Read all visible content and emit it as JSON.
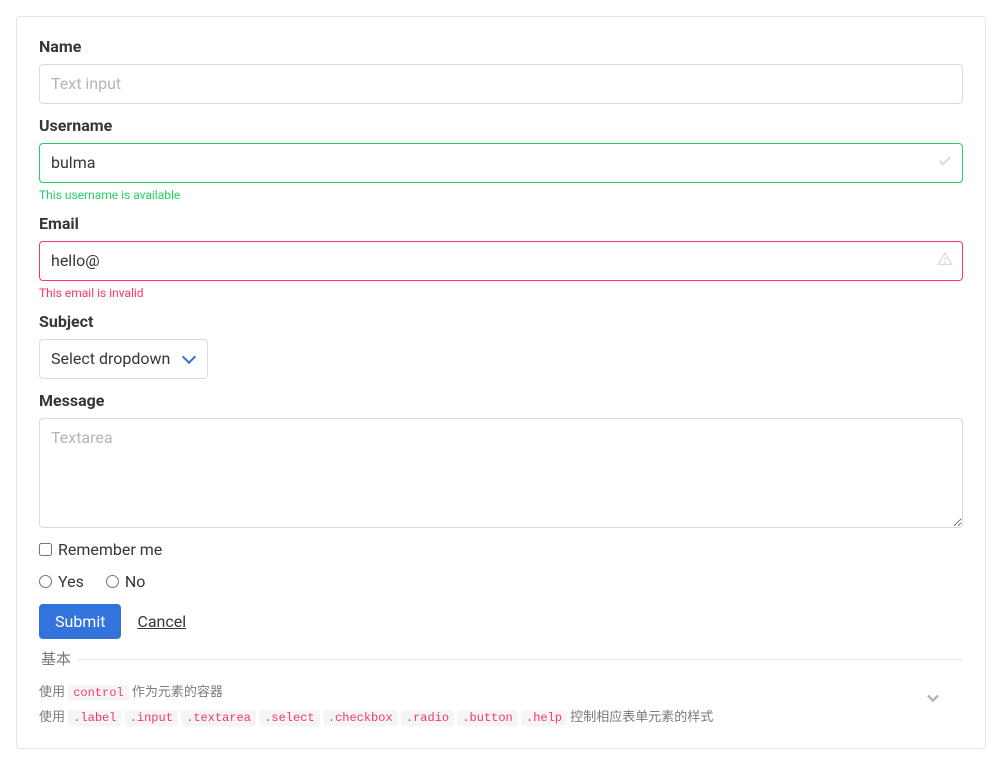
{
  "form": {
    "name": {
      "label": "Name",
      "placeholder": "Text input"
    },
    "username": {
      "label": "Username",
      "value": "bulma",
      "help": "This username is available"
    },
    "email": {
      "label": "Email",
      "value": "hello@",
      "help": "This email is invalid"
    },
    "subject": {
      "label": "Subject",
      "selected": "Select dropdown"
    },
    "message": {
      "label": "Message",
      "placeholder": "Textarea"
    },
    "remember": {
      "label": "Remember me"
    },
    "radio": {
      "yes": "Yes",
      "no": "No"
    },
    "submit": "Submit",
    "cancel": "Cancel"
  },
  "legend": {
    "title": "基本",
    "line1_prefix": "使用 ",
    "line1_code": "control",
    "line1_suffix": " 作为元素的容器",
    "line2_prefix": "使用 ",
    "line2_codes": [
      ".label",
      ".input",
      ".textarea",
      ".select",
      ".checkbox",
      ".radio",
      ".button",
      ".help"
    ],
    "line2_suffix": " 控制相应表单元素的样式"
  }
}
